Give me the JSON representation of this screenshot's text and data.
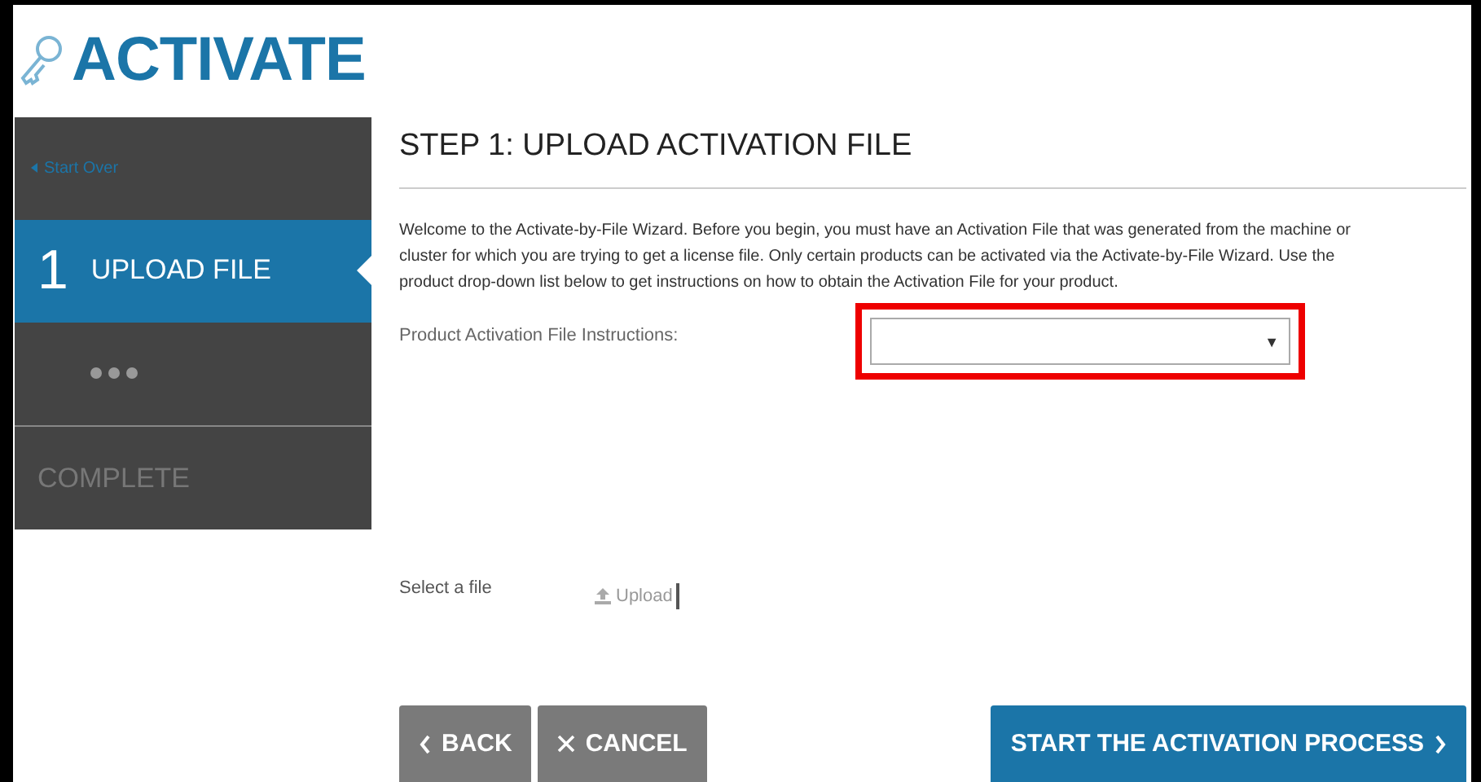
{
  "logo": {
    "text": "ACTIVATE"
  },
  "sidebar": {
    "start_over": "Start Over",
    "steps": [
      {
        "kind": "step",
        "number": "1",
        "label": "UPLOAD FILE",
        "selected": true
      },
      {
        "kind": "dots",
        "selected": false
      },
      {
        "kind": "step",
        "label": "COMPLETE",
        "selected": false
      }
    ]
  },
  "main": {
    "title": "STEP 1: UPLOAD ACTIVATION FILE",
    "intro": "Welcome to the Activate-by-File Wizard. Before you begin, you must have an Activation File that was generated from the machine or cluster for which you are trying to get a license file. Only certain products can be activated via the Activate-by-File Wizard. Use the product drop-down list below to get instructions on how to obtain the Activation File for your product.",
    "product_select": {
      "label": "Product Activation File Instructions:",
      "caret": "▼",
      "highlighted": true
    },
    "file": {
      "label": "Select a file",
      "button": "Upload"
    },
    "buttons": [
      {
        "kind": "back",
        "label": "BACK"
      },
      {
        "kind": "cancel",
        "label": "CANCEL"
      },
      {
        "kind": "start",
        "label": "START THE ACTIVATION PROCESS"
      }
    ]
  }
}
